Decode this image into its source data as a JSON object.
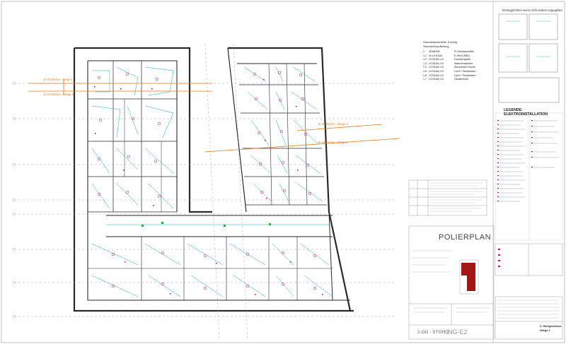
{
  "drawing": {
    "title": "POLIERPLAN",
    "strip_label": "2.OG - STGH 1",
    "strip_code": "KNG-E2",
    "sheet_floor": "2. Obergeschoss",
    "sheet_stiege": "Stiege 1"
  },
  "annotations": {
    "orange_1": "E-VS Decke - Stege 1",
    "orange_2": "E-VS Decke - Stiege 1",
    "orange_3": "E-VS Decke - Stiege 1",
    "orange_4": "E-VS Decke - Stiege 1"
  },
  "circuit_list": {
    "heading": "Stromkreisverteiler 3-reihig",
    "subheading": "Stromkreisaufteilung",
    "rows": [
      {
        "no": "1",
        "code": "4DIAE30L",
        "desc": "FI-Schutzschalter"
      },
      {
        "no": "1.1",
        "code": "3x LS B16A",
        "desc": "E-Herd (KBD)"
      },
      {
        "no": "1.2",
        "code": "LS B16A 1-N",
        "desc": "Geschirrspüler"
      },
      {
        "no": "1.3",
        "code": "LS B16A 1-N",
        "desc": "Waschmaschine"
      },
      {
        "no": "1.4",
        "code": "LS B16A 1-N",
        "desc": "Steckdosen Küche"
      },
      {
        "no": "1.5",
        "code": "LS B16A 1-N",
        "desc": "Licht + Steckdosen"
      },
      {
        "no": "1.6",
        "code": "LS B16A 1-N",
        "desc": "Licht + Steckdosen"
      },
      {
        "no": "1.7",
        "code": "LS B16A 1-N",
        "desc": "Haustechnik"
      }
    ]
  },
  "legend": {
    "title": "LEGENDE-ELEKTROINSTALLATION",
    "top_title": "Montagehöhen wenn nicht anders angegeben"
  },
  "colors": {
    "wall": "#2a2a2a",
    "cyan": "#1aa9c9",
    "magenta": "#c0166a",
    "orange": "#e07b1a",
    "green": "#2bb02b",
    "red_block": "#a31616"
  }
}
